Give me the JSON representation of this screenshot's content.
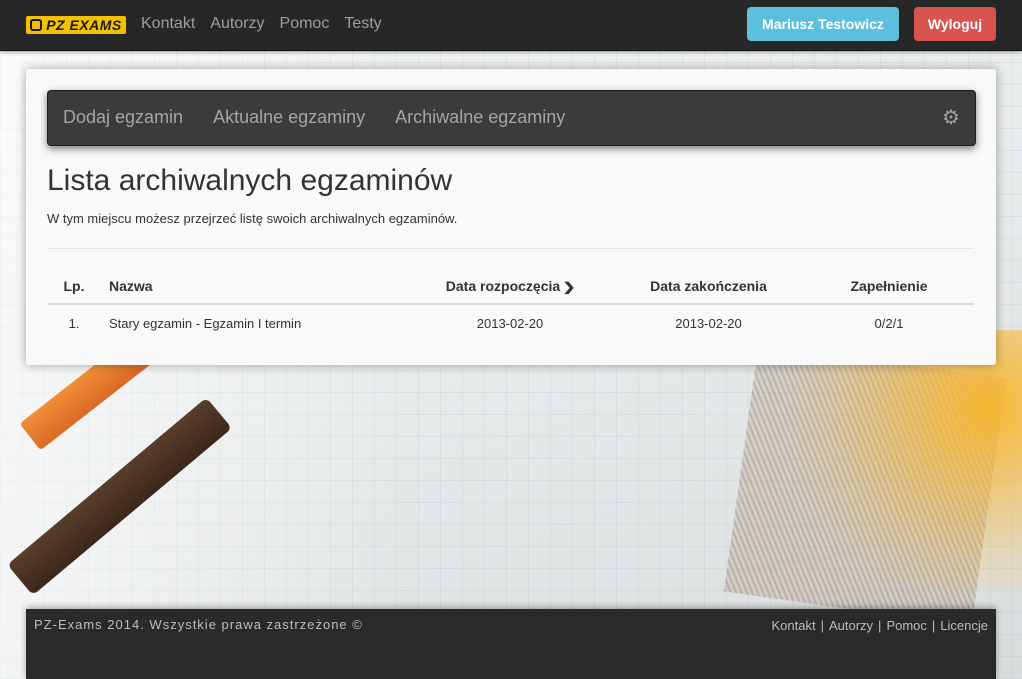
{
  "navbar": {
    "brand": "PZ EXAMS",
    "links": [
      "Kontakt",
      "Autorzy",
      "Pomoc",
      "Testy"
    ],
    "user_button": "Mariusz Testowicz",
    "logout_button": "Wyloguj"
  },
  "subnav": {
    "tabs": [
      "Dodaj egzamin",
      "Aktualne egzaminy",
      "Archiwalne egzaminy"
    ],
    "settings_icon": "gear-icon"
  },
  "page": {
    "title": "Lista archiwalnych egzaminów",
    "description": "W tym miejscu możesz przejrzeć listę swoich archiwalnych egzaminów."
  },
  "table": {
    "headers": {
      "lp": "Lp.",
      "name": "Nazwa",
      "start": "Data rozpoczęcia",
      "end": "Data zakończenia",
      "fill": "Zapełnienie"
    },
    "sort_icon": "chevron-down-icon",
    "rows": [
      {
        "lp": "1.",
        "name": "Stary egzamin - Egzamin I termin",
        "start": "2013-02-20",
        "end": "2013-02-20",
        "fill": "0/2/1"
      }
    ]
  },
  "footer": {
    "copyright": "PZ-Exams 2014. Wszystkie prawa zastrzeżone ©",
    "links": [
      "Kontakt",
      "Autorzy",
      "Pomoc",
      "Licencje"
    ],
    "separator": "|"
  },
  "colors": {
    "navbar_bg": "#272727",
    "user_button": "#5bc0de",
    "logout_button": "#d9534f",
    "brand": "#f2c200"
  }
}
